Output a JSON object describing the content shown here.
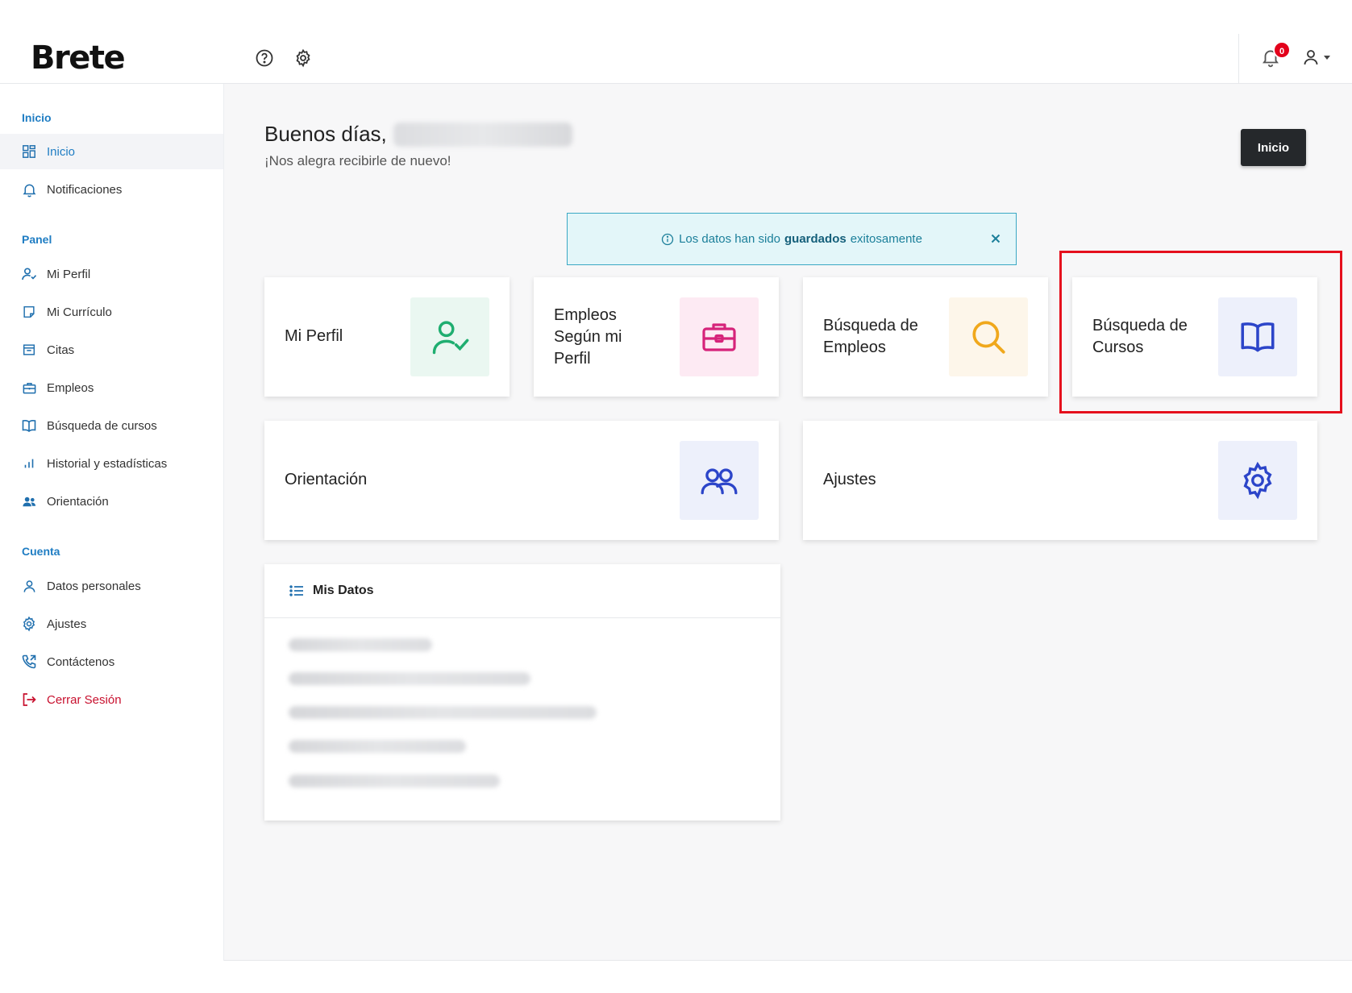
{
  "header": {
    "logo": "Brete",
    "help_icon": "help-circle-icon",
    "settings_icon": "gear-icon",
    "notifications_count": "0",
    "user_icon": "user-icon"
  },
  "sidebar": {
    "sections": [
      {
        "title": "Inicio",
        "items": [
          {
            "label": "Inicio",
            "icon": "dashboard-icon",
            "active": true
          },
          {
            "label": "Notificaciones",
            "icon": "bell-icon"
          }
        ]
      },
      {
        "title": "Panel",
        "items": [
          {
            "label": "Mi Perfil",
            "icon": "user-check-icon"
          },
          {
            "label": "Mi Currículo",
            "icon": "document-icon"
          },
          {
            "label": "Citas",
            "icon": "calendar-icon"
          },
          {
            "label": "Empleos",
            "icon": "briefcase-icon"
          },
          {
            "label": "Búsqueda de cursos",
            "icon": "book-icon"
          },
          {
            "label": "Historial y estadísticas",
            "icon": "bar-chart-icon"
          },
          {
            "label": "Orientación",
            "icon": "users-icon"
          }
        ]
      },
      {
        "title": "Cuenta",
        "items": [
          {
            "label": "Datos personales",
            "icon": "user-icon"
          },
          {
            "label": "Ajustes",
            "icon": "gear-icon"
          },
          {
            "label": "Contáctenos",
            "icon": "phone-icon"
          },
          {
            "label": "Cerrar Sesión",
            "icon": "logout-icon",
            "danger": true
          }
        ]
      }
    ]
  },
  "main": {
    "greeting": "Buenos días,",
    "subgreeting": "¡Nos alegra recibirle de nuevo!",
    "inicio_button": "Inicio",
    "alert": {
      "before": "Los datos han sido",
      "bold": "guardados",
      "after": "exitosamente"
    },
    "cards": [
      {
        "label_lines": [
          "Mi Perfil"
        ],
        "icon": "user-check-icon",
        "color": "#1fae70",
        "bg": "#eaf7f1"
      },
      {
        "label_lines": [
          "Empleos",
          "Según mi",
          "Perfil"
        ],
        "icon": "briefcase-icon",
        "color": "#d6237a",
        "bg": "#fdeaf3"
      },
      {
        "label_lines": [
          "Búsqueda de",
          "Empleos"
        ],
        "icon": "search-icon",
        "color": "#f0a81c",
        "bg": "#fdf6ea"
      },
      {
        "label_lines": [
          "Búsqueda de",
          "Cursos"
        ],
        "icon": "book-icon",
        "color": "#2c45c9",
        "bg": "#edf0fb"
      },
      {
        "label_lines": [
          "Orientación"
        ],
        "icon": "users-icon",
        "color": "#2c45c9",
        "bg": "#edf0fb"
      },
      {
        "label_lines": [
          "Ajustes"
        ],
        "icon": "gear-icon",
        "color": "#2c45c9",
        "bg": "#edf0fb"
      }
    ],
    "mis_datos": {
      "title": "Mis Datos",
      "icon": "list-icon"
    }
  },
  "colors": {
    "accent": "#1f7dc3",
    "danger": "#c8102e",
    "highlight": "#e5101d"
  }
}
